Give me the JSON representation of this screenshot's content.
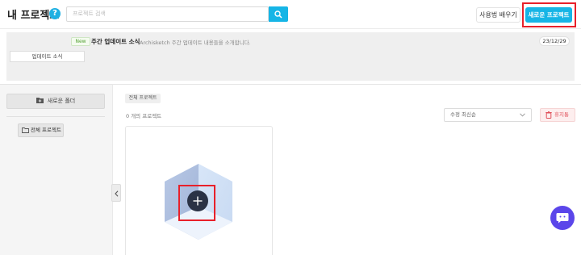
{
  "header": {
    "title": "내 프로젝트",
    "help_icon": "question-icon",
    "search_placeholder": "프로젝트 검색",
    "learn_label": "사용법 배우기",
    "new_project_label": "새로운 프로젝트"
  },
  "banner": {
    "update_news_label": "업데이트 소식",
    "new_badge": "New",
    "title": "주간 업데이트 소식",
    "description": "Archisketch 주간 업데이트 내용들을 소개합니다.",
    "date": "23/12/29"
  },
  "sidebar": {
    "new_folder_label": "새로운 폴더",
    "all_projects_label": "전체 프로젝트"
  },
  "main": {
    "breadcrumb": "전체 프로젝트",
    "count_text": "0 개의 프로젝트",
    "sort_value": "수정 최신순",
    "trash_label": "휴지통"
  },
  "colors": {
    "accent": "#16b5e6",
    "highlight": "#e8202a",
    "chat": "#5b46ea",
    "add_button": "#2a3245"
  }
}
